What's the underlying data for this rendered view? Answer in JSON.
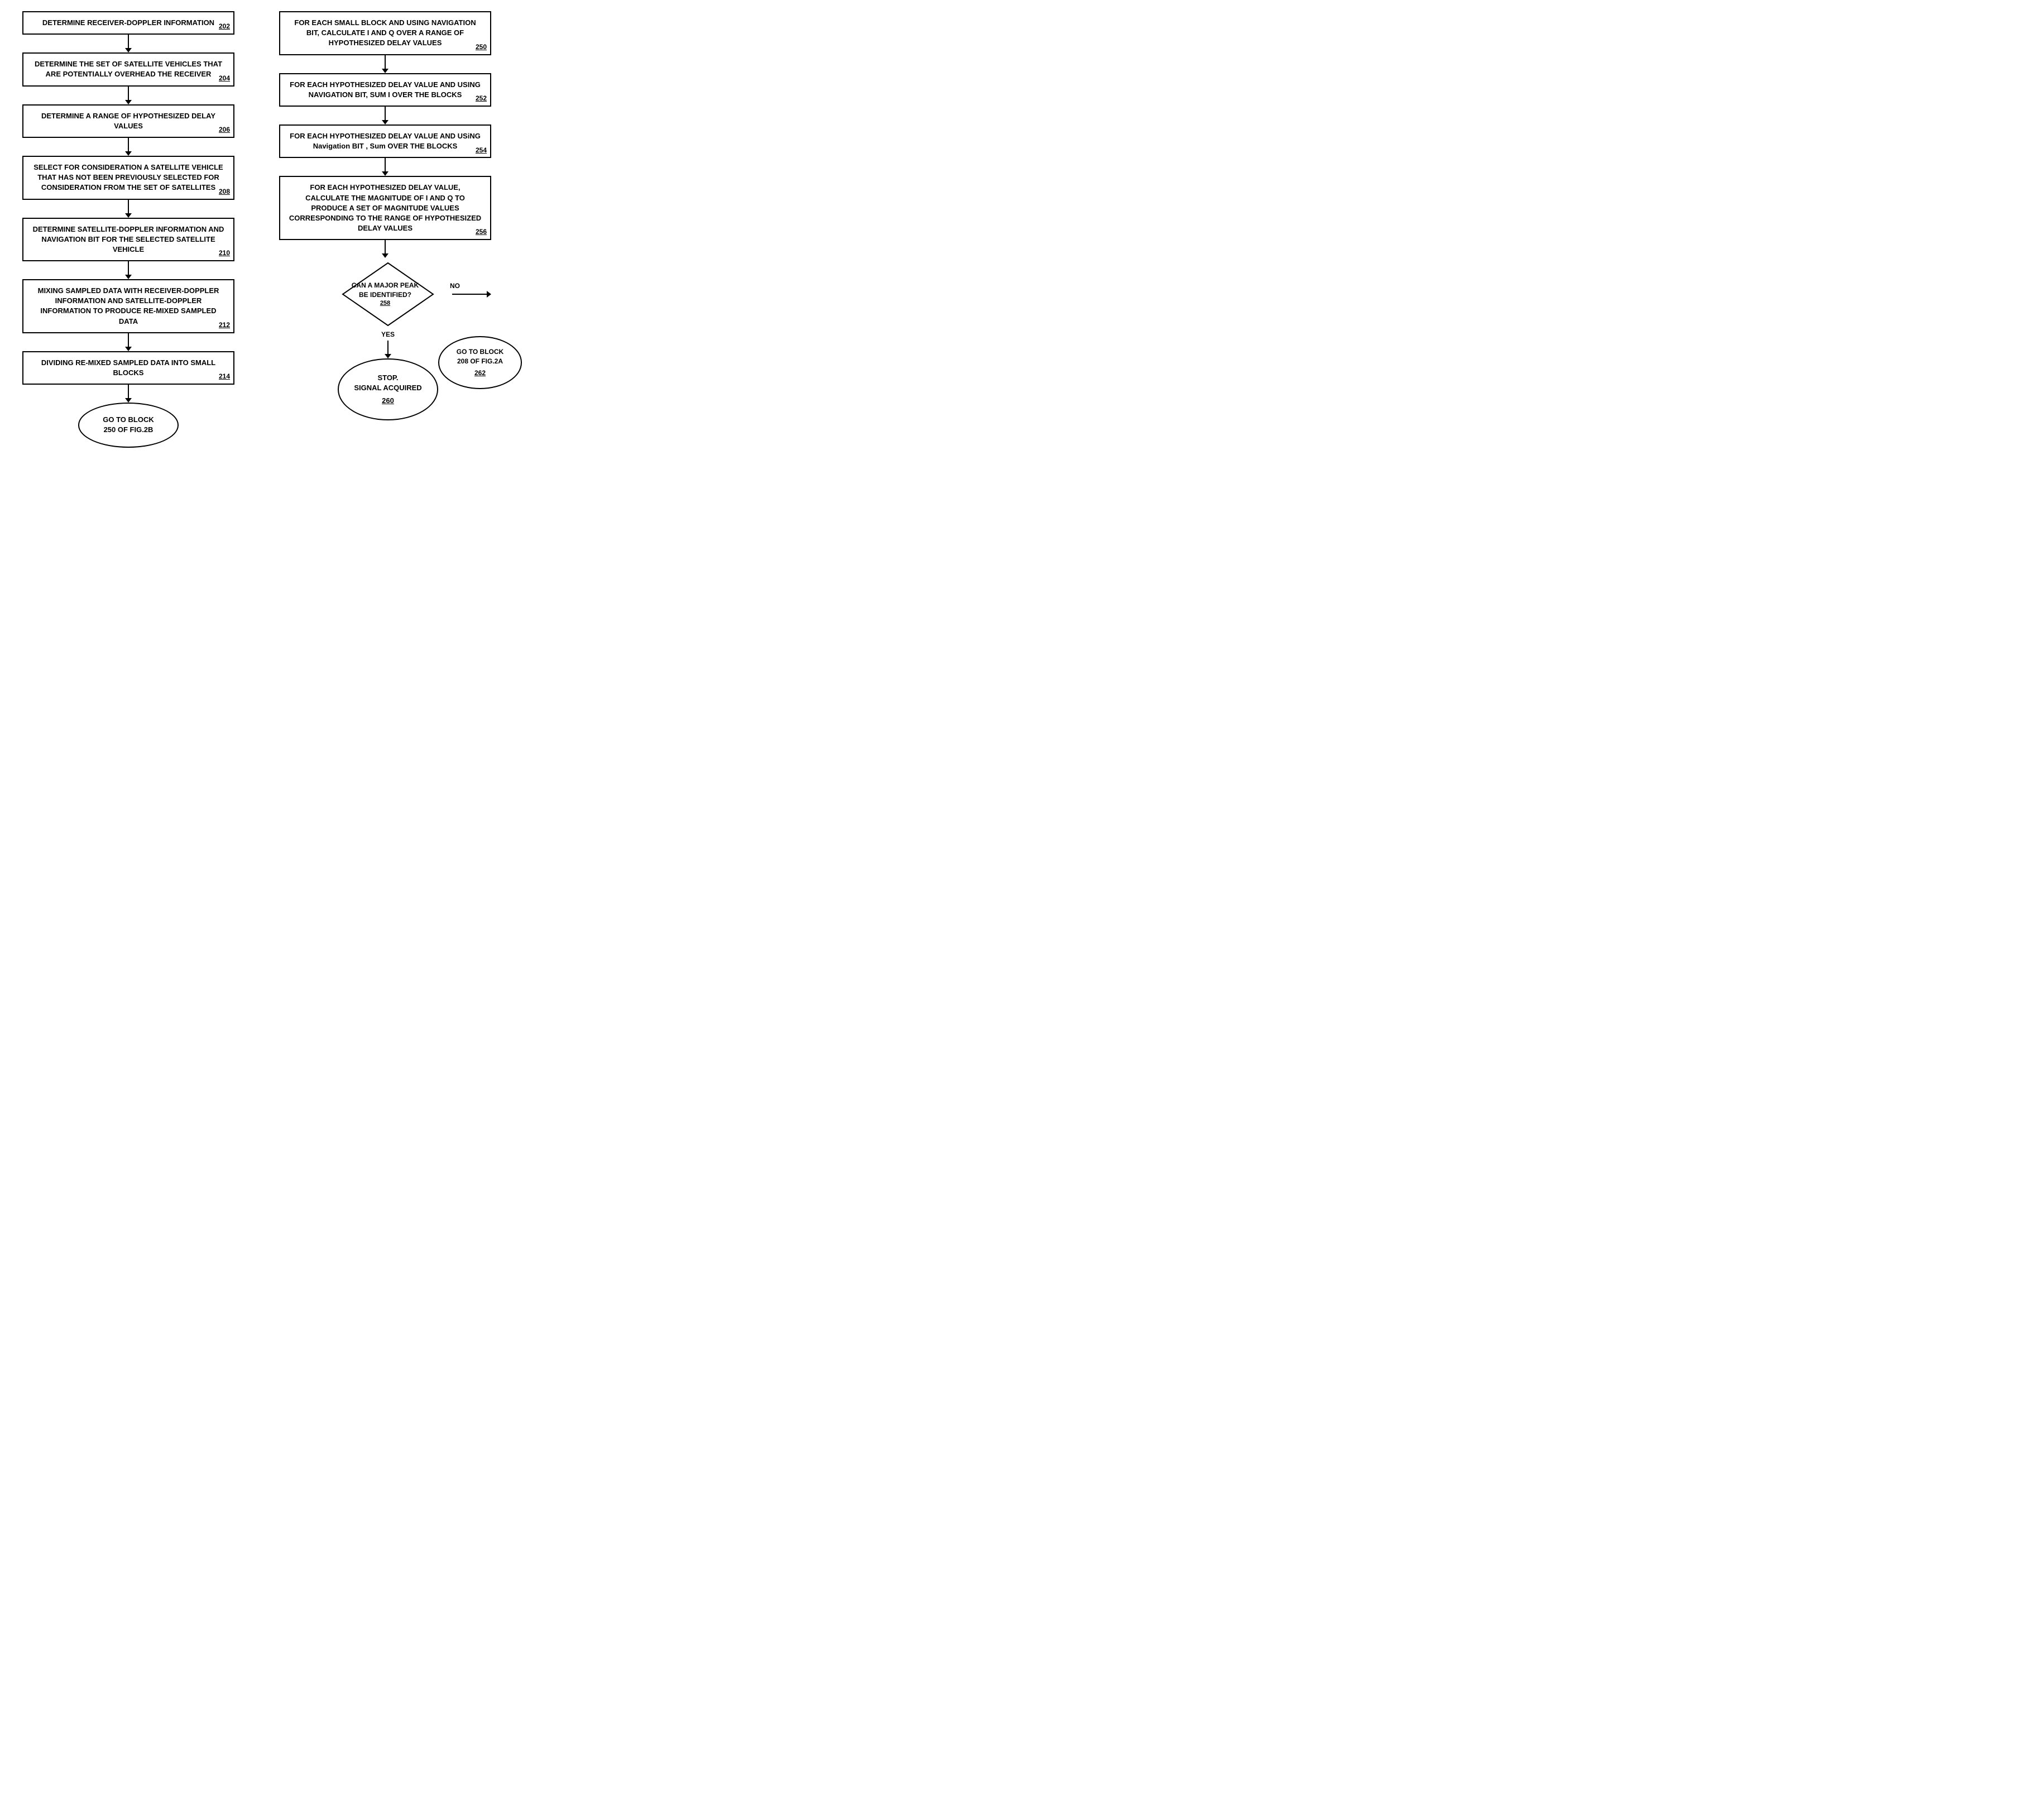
{
  "left": {
    "blocks": [
      {
        "id": "202",
        "text": "DETERMINE RECEIVER-DOPPLER INFORMATION",
        "number": "202"
      },
      {
        "id": "204",
        "text": "DETERMINE THE SET OF SATELLITE VEHICLES THAT ARE POTENTIALLY OVERHEAD THE RECEIVER",
        "number": "204"
      },
      {
        "id": "206",
        "text": "DETERMINE A RANGE OF HYPOTHESIZED DELAY VALUES",
        "number": "206"
      },
      {
        "id": "208",
        "text": "SELECT FOR CONSIDERATION A SATELLITE VEHICLE THAT HAS NOT BEEN PREVIOUSLY SELECTED FOR CONSIDERATION FROM THE SET OF SATELLITES",
        "number": "208"
      },
      {
        "id": "210",
        "text": "DETERMINE SATELLITE-DOPPLER INFORMATION AND NAVIGATION BIT FOR THE SELECTED SATELLITE VEHICLE",
        "number": "210"
      },
      {
        "id": "212",
        "text": "MIXING SAMPLED DATA  WITH RECEIVER-DOPPLER INFORMATION AND SATELLITE-DOPPLER INFORMATION TO PRODUCE RE-MIXED SAMPLED DATA",
        "number": "212"
      },
      {
        "id": "214",
        "text": "DIVIDING RE-MIXED SAMPLED DATA INTO SMALL BLOCKS",
        "number": "214"
      }
    ],
    "goto_oval": {
      "line1": "GO TO BLOCK",
      "line2": "250 OF FIG.2B"
    }
  },
  "right": {
    "blocks": [
      {
        "id": "250",
        "text": "FOR EACH SMALL BLOCK AND USING NAVIGATION BIT, CALCULATE I AND Q OVER A RANGE OF HYPOTHESIZED DELAY VALUES",
        "number": "250"
      },
      {
        "id": "252",
        "text": "FOR EACH HYPOTHESIZED DELAY VALUE AND USING NAVIGATION BIT, SUM I OVER THE BLOCKS",
        "number": "252"
      },
      {
        "id": "254",
        "text": "FOR EACH HYPOTHESIZED DELAY VALUE AND USiNG Navigation BIT , Sum  OVER THE BLOCKS",
        "number": "254"
      },
      {
        "id": "256",
        "text": "FOR EACH HYPOTHESIZED DELAY VALUE, CALCULATE THE MAGNITUDE OF I AND Q TO PRODUCE A SET OF MAGNITUDE VALUES CORRESPONDING TO THE RANGE OF HYPOTHESIZED DELAY VALUES",
        "number": "256"
      }
    ],
    "diamond": {
      "question": "CAN A MAJOR PEAK BE IDENTIFIED?",
      "number": "258",
      "no_label": "NO",
      "yes_label": "YES"
    },
    "no_oval": {
      "line1": "GO TO BLOCK",
      "line2": "208 OF FIG.2A",
      "number": "262"
    },
    "yes_oval": {
      "line1": "STOP.",
      "line2": "SIGNAL ACQUIRED",
      "number": "260"
    }
  }
}
